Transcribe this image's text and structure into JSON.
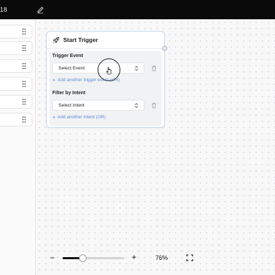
{
  "topbar": {
    "title": "18",
    "edit_icon": "pencil-icon"
  },
  "sidebar": {
    "items": [
      {
        "drag_icon": "drag-handle-icon"
      },
      {
        "drag_icon": "drag-handle-icon"
      },
      {
        "drag_icon": "drag-handle-icon"
      },
      {
        "drag_icon": "drag-handle-icon"
      },
      {
        "drag_icon": "drag-handle-icon"
      },
      {
        "drag_icon": "drag-handle-icon"
      }
    ]
  },
  "node": {
    "title": "Start Trigger",
    "icon": "rocket-icon",
    "trigger_event": {
      "label": "Trigger Event",
      "selected": "Select Event",
      "add_link": "Add another trigger event (OR)"
    },
    "filter_intent": {
      "label": "Filter by Intent",
      "selected": "Select Intent",
      "add_link": "Add another intent (OR)"
    }
  },
  "zoom": {
    "minus": "−",
    "plus": "+",
    "level_text": "76%",
    "slider_fraction": 0.33
  },
  "colors": {
    "accent_link": "#5b8bd6",
    "node_border": "#c9d7ea",
    "topbar": "#0a0a0a"
  }
}
